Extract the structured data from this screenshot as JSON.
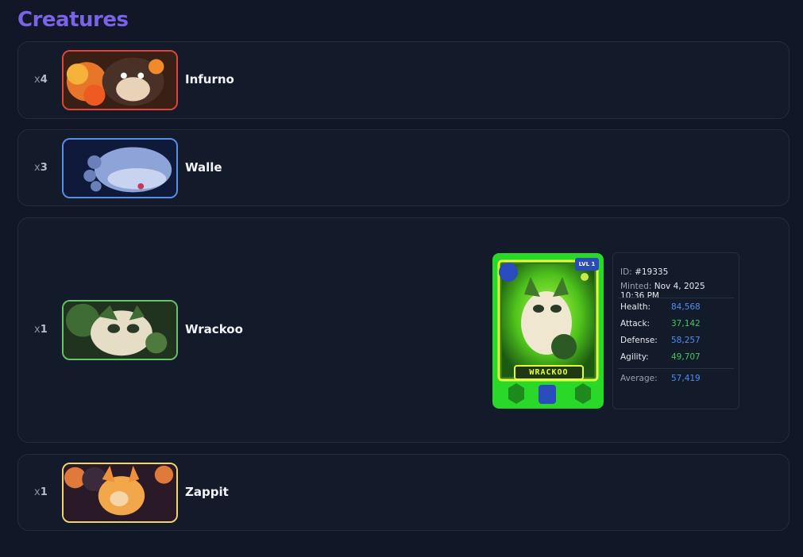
{
  "page_title": "Creatures",
  "creatures": [
    {
      "qty_prefix": "x",
      "qty": "4",
      "name": "Infurno",
      "border": "#e0453a"
    },
    {
      "qty_prefix": "x",
      "qty": "3",
      "name": "Walle",
      "border": "#5a8fe6"
    },
    {
      "qty_prefix": "x",
      "qty": "1",
      "name": "Wrackoo",
      "border": "#67c26a"
    },
    {
      "qty_prefix": "x",
      "qty": "1",
      "name": "Zappit",
      "border": "#f0d56a"
    }
  ],
  "card": {
    "level_badge": "LVL 1",
    "nameplate": "WRACKOO",
    "id_label": "ID:",
    "id_value": "#19335",
    "minted_label": "Minted:",
    "minted_value": "Nov 4, 2025 10:36 PM",
    "stats": [
      {
        "label": "Health:",
        "value": "84,568",
        "color": "#4d8ef0"
      },
      {
        "label": "Attack:",
        "value": "37,142",
        "color": "#3ccb5a"
      },
      {
        "label": "Defense:",
        "value": "58,257",
        "color": "#4d8ef0"
      },
      {
        "label": "Agility:",
        "value": "49,707",
        "color": "#3ccb5a"
      }
    ],
    "average_label": "Average:",
    "average_value": "57,419",
    "average_color": "#4d8ef0"
  }
}
